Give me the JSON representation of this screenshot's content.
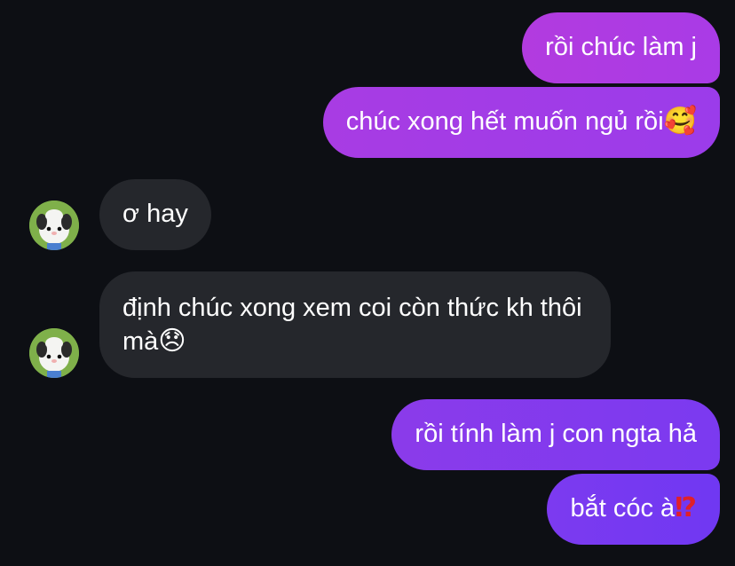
{
  "messages": [
    {
      "id": "m1",
      "sender": "me",
      "text": "rồi chúc làm j",
      "emoji": ""
    },
    {
      "id": "m2",
      "sender": "me",
      "text": "chúc xong hết muốn ngủ rồi",
      "emoji": "🥰"
    },
    {
      "id": "m3",
      "sender": "them",
      "text": "ơ hay",
      "emoji": ""
    },
    {
      "id": "m4",
      "sender": "them",
      "text": "định chúc xong xem coi còn thức kh thôi mà",
      "emoji": "😞"
    },
    {
      "id": "m5",
      "sender": "me",
      "text": "rồi tính làm j con ngta hả",
      "emoji": ""
    },
    {
      "id": "m6",
      "sender": "me",
      "text": "bắt cóc à",
      "emoji": "⁉"
    }
  ],
  "contact": {
    "avatar_icon": "puppy-character-avatar"
  },
  "colors": {
    "background": "#0d0f14",
    "incoming_bubble": "#25272c",
    "outgoing_gradient_top": "#b23bdf",
    "outgoing_gradient_bottom": "#7038f2",
    "text": "#ffffff"
  }
}
